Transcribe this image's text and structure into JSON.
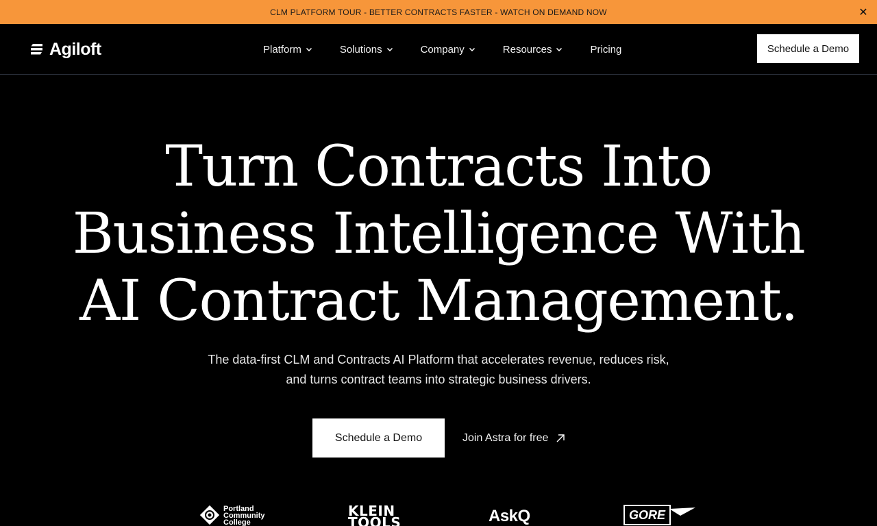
{
  "announcement": {
    "text": "CLM PLATFORM TOUR - BETTER CONTRACTS FASTER - WATCH ON DEMAND NOW",
    "close_label": "✕",
    "background": "#f7963a"
  },
  "header": {
    "logo_text": "Agiloft",
    "nav": [
      {
        "label": "Platform",
        "icon": "chevron-down-icon"
      },
      {
        "label": "Solutions",
        "icon": "chevron-down-icon"
      },
      {
        "label": "Company",
        "icon": "chevron-down-icon"
      },
      {
        "label": "Resources",
        "icon": "chevron-down-icon"
      },
      {
        "label": "Pricing"
      }
    ],
    "cta_label": "Schedule a Demo"
  },
  "hero": {
    "title_lines": [
      "Turn Contracts Into",
      "Business Intelligence With",
      "AI Contract Management."
    ],
    "subtitle": "The data-first CLM and Contracts AI Platform that accelerates revenue, reduces risk, and turns contract teams into strategic business drivers.",
    "primary_cta": "Schedule a Demo",
    "secondary_cta": "Join Astra for free",
    "secondary_icon": "arrow-up-right-icon"
  },
  "customer_logos": {
    "portland": [
      "Portland",
      "Community",
      "College"
    ],
    "klein": [
      "KLEIN",
      "TOOLS"
    ],
    "askq": "AskQ",
    "gore": "GORE"
  }
}
